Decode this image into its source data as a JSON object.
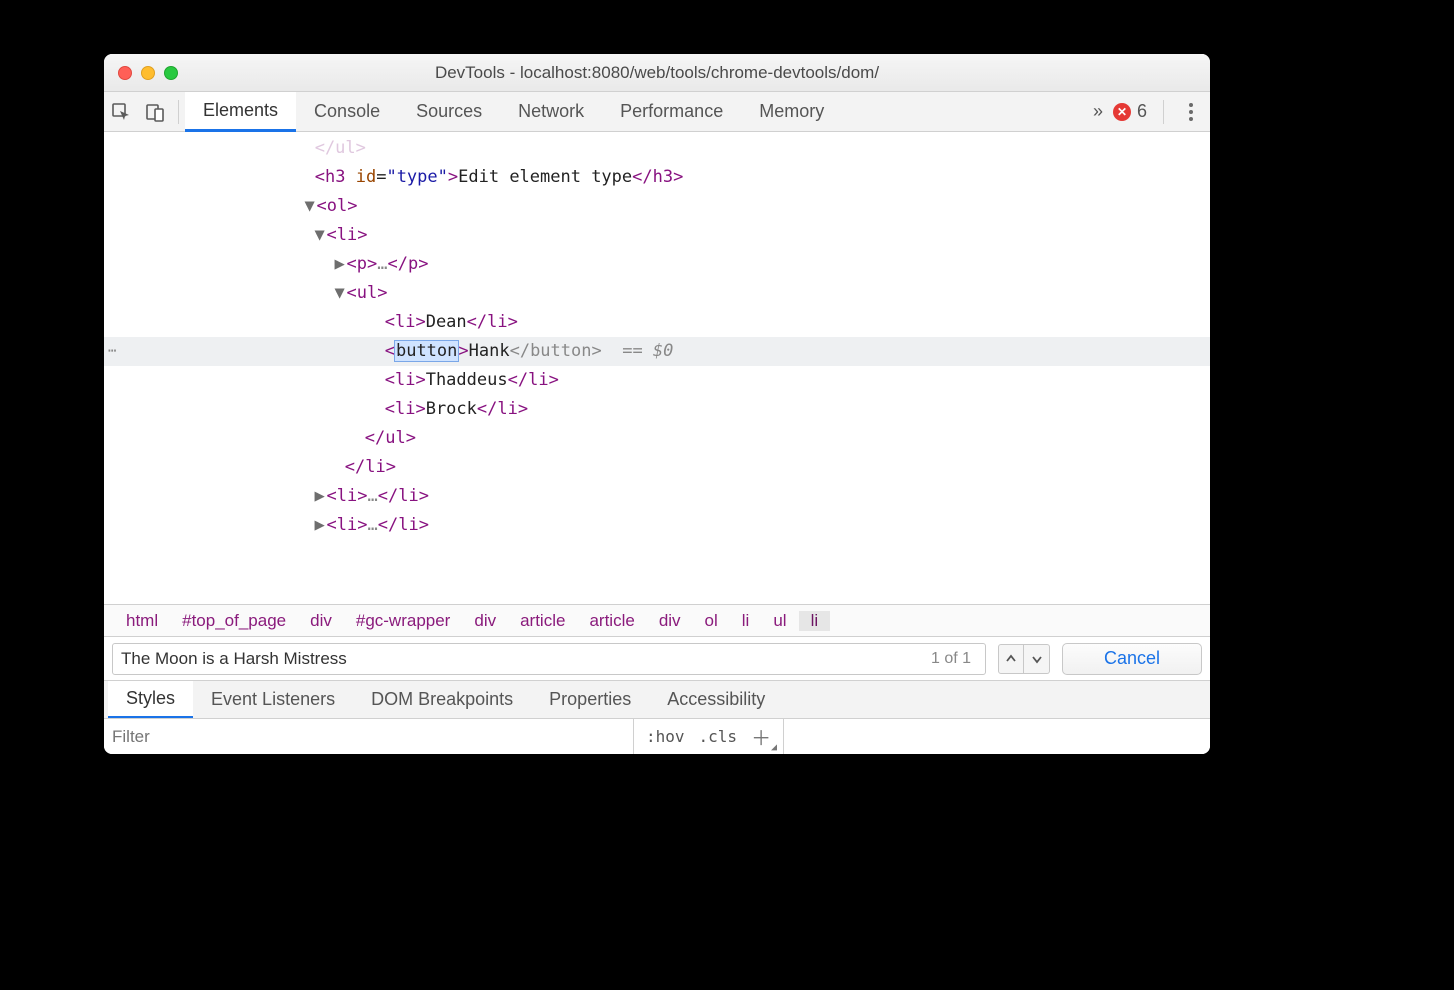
{
  "window": {
    "title": "DevTools - localhost:8080/web/tools/chrome-devtools/dom/"
  },
  "toolbar": {
    "tabs": [
      "Elements",
      "Console",
      "Sources",
      "Network",
      "Performance",
      "Memory"
    ],
    "active_tab": "Elements",
    "overflow": "»",
    "error_count": "6"
  },
  "dom": {
    "line0": "</ul>",
    "h3_id": "type",
    "h3_text": "Edit element type",
    "list_items": {
      "dean": "Dean",
      "hank": "Hank",
      "thaddeus": "Thaddeus",
      "brock": "Brock"
    },
    "edit_tag": "button",
    "close_edit": "</button>",
    "d0": "== $0",
    "ellipsis": "…"
  },
  "breadcrumb": [
    "html",
    "#top_of_page",
    "div",
    "#gc-wrapper",
    "div",
    "article",
    "article",
    "div",
    "ol",
    "li",
    "ul",
    "li"
  ],
  "search": {
    "value": "The Moon is a Harsh Mistress",
    "count": "1 of 1",
    "cancel": "Cancel"
  },
  "subtabs": [
    "Styles",
    "Event Listeners",
    "DOM Breakpoints",
    "Properties",
    "Accessibility"
  ],
  "active_subtab": "Styles",
  "filter": {
    "placeholder": "Filter",
    "hov": ":hov",
    "cls": ".cls"
  }
}
